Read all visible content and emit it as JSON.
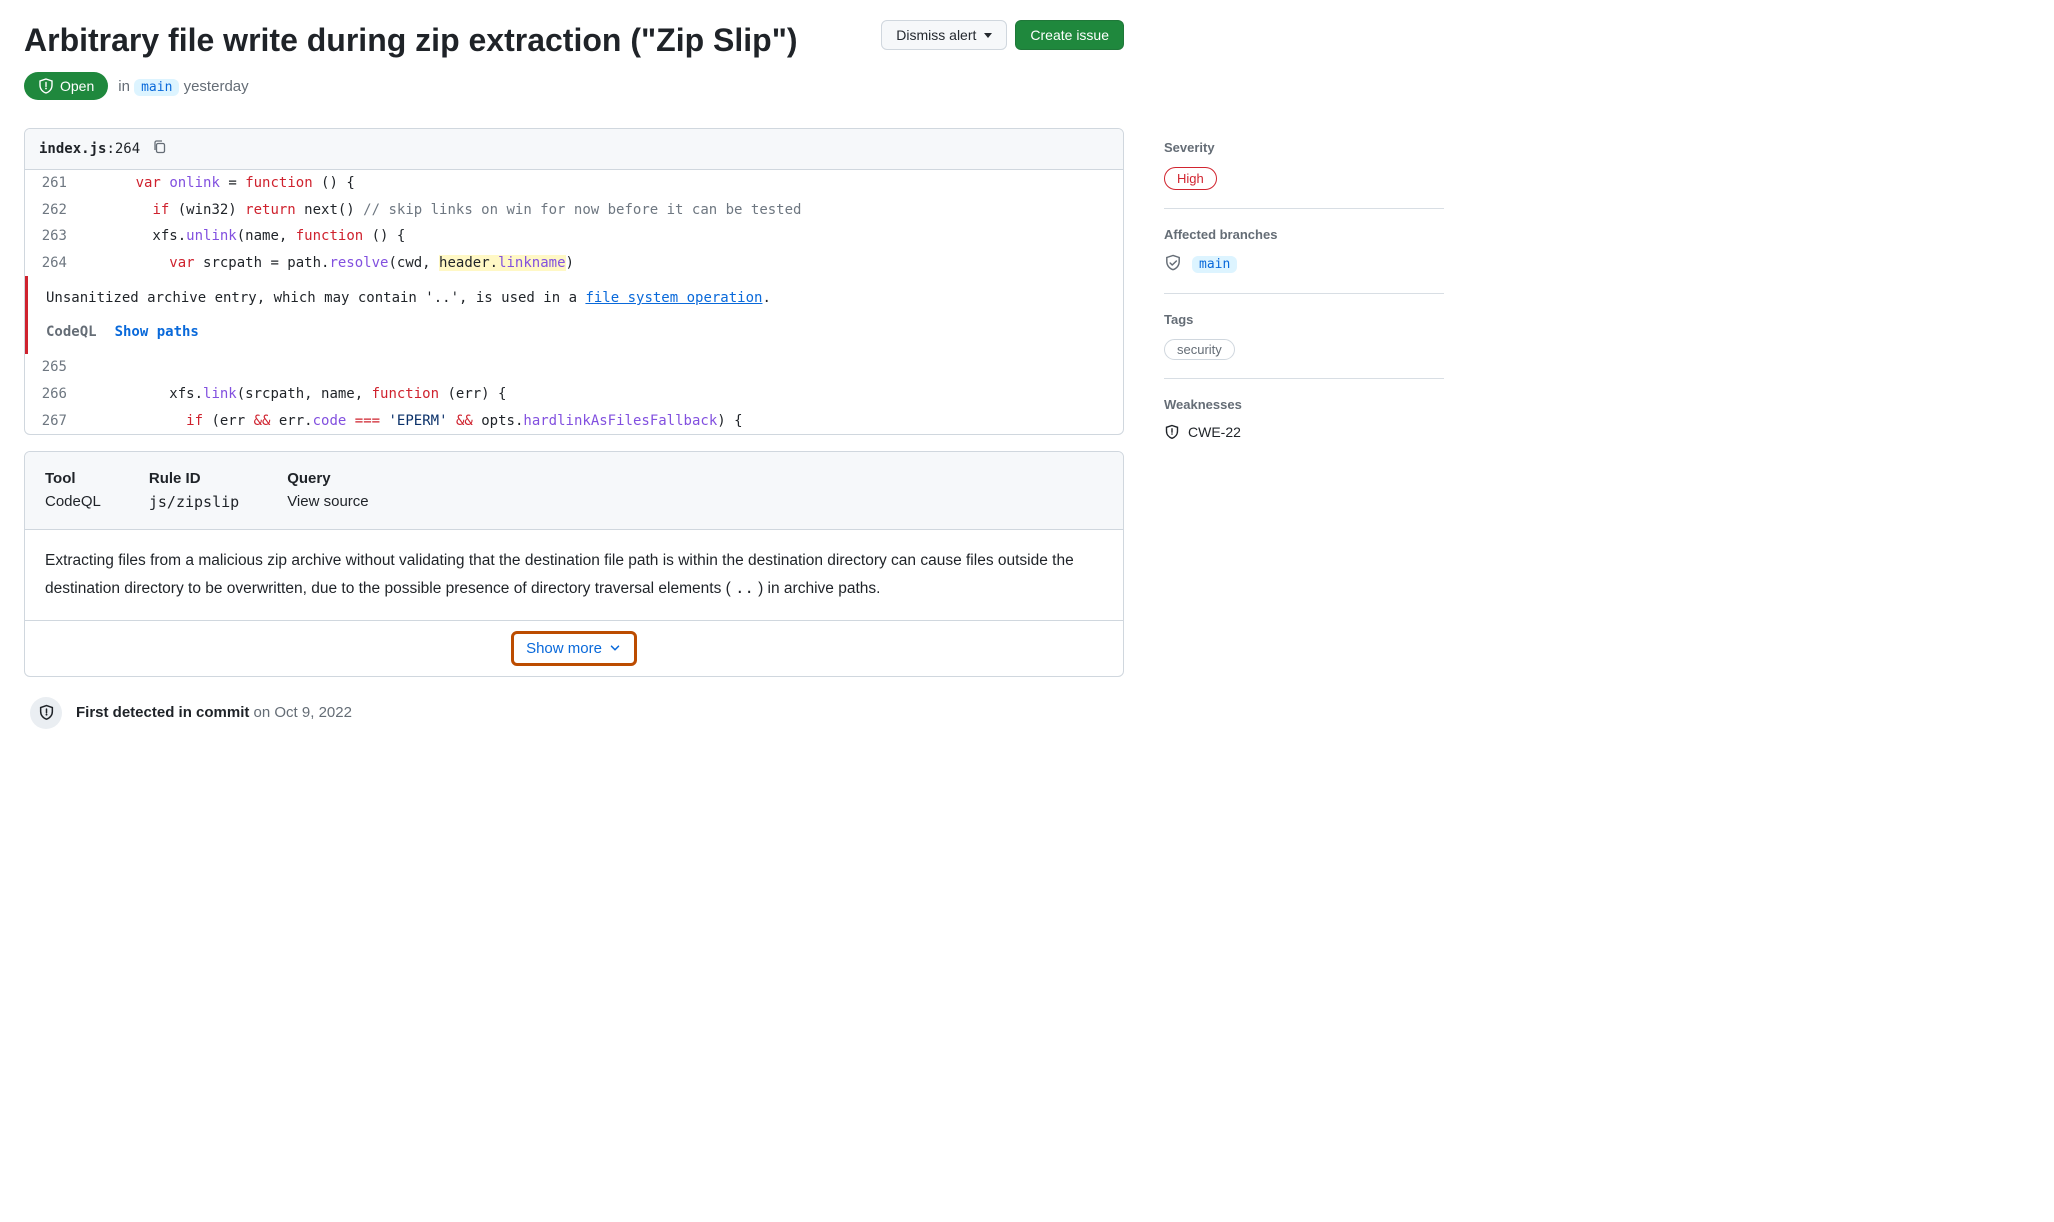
{
  "header": {
    "title": "Arbitrary file write during zip extraction (\"Zip Slip\")",
    "dismiss_label": "Dismiss alert",
    "create_issue_label": "Create issue"
  },
  "status": {
    "state": "Open",
    "in_label": "in",
    "branch": "main",
    "when": "yesterday"
  },
  "code_header": {
    "filename": "index.js",
    "line": "264"
  },
  "code": {
    "lines_before": [
      {
        "num": "261",
        "tokens": [
          {
            "t": "      "
          },
          {
            "t": "var",
            "c": "kw"
          },
          {
            "t": " "
          },
          {
            "t": "onlink",
            "c": "fn"
          },
          {
            "t": " = "
          },
          {
            "t": "function",
            "c": "kw"
          },
          {
            "t": " () {"
          }
        ]
      },
      {
        "num": "262",
        "tokens": [
          {
            "t": "        "
          },
          {
            "t": "if",
            "c": "kw"
          },
          {
            "t": " (win32) "
          },
          {
            "t": "return",
            "c": "kw"
          },
          {
            "t": " next() "
          },
          {
            "t": "// skip links on win for now before it can be tested",
            "c": "cm"
          }
        ]
      },
      {
        "num": "263",
        "tokens": [
          {
            "t": "        xfs."
          },
          {
            "t": "unlink",
            "c": "fn"
          },
          {
            "t": "(name, "
          },
          {
            "t": "function",
            "c": "kw"
          },
          {
            "t": " () {"
          }
        ]
      },
      {
        "num": "264",
        "tokens": [
          {
            "t": "          "
          },
          {
            "t": "var",
            "c": "kw"
          },
          {
            "t": " srcpath = path."
          },
          {
            "t": "resolve",
            "c": "fn"
          },
          {
            "t": "(cwd, "
          },
          {
            "t": "header.",
            "c": "hl"
          },
          {
            "t": "linkname",
            "c": "hl-fn"
          },
          {
            "t": ")"
          }
        ]
      }
    ],
    "lines_after": [
      {
        "num": "265",
        "tokens": []
      },
      {
        "num": "266",
        "tokens": [
          {
            "t": "          xfs."
          },
          {
            "t": "link",
            "c": "fn"
          },
          {
            "t": "(srcpath, name, "
          },
          {
            "t": "function",
            "c": "kw"
          },
          {
            "t": " (err) {"
          }
        ]
      },
      {
        "num": "267",
        "tokens": [
          {
            "t": "            "
          },
          {
            "t": "if",
            "c": "kw"
          },
          {
            "t": " (err "
          },
          {
            "t": "&&",
            "c": "kw"
          },
          {
            "t": " err."
          },
          {
            "t": "code",
            "c": "fn"
          },
          {
            "t": " "
          },
          {
            "t": "===",
            "c": "kw"
          },
          {
            "t": " "
          },
          {
            "t": "'EPERM'",
            "c": "str"
          },
          {
            "t": " "
          },
          {
            "t": "&&",
            "c": "kw"
          },
          {
            "t": " opts."
          },
          {
            "t": "hardlinkAsFilesFallback",
            "c": "fn"
          },
          {
            "t": ") {"
          }
        ]
      }
    ]
  },
  "alert": {
    "msg_pre": "Unsanitized archive entry, which may contain '..', is used in a ",
    "msg_link": "file system operation",
    "msg_post": ".",
    "codeql_label": "CodeQL",
    "show_paths": "Show paths"
  },
  "details": {
    "cols": [
      {
        "label": "Tool",
        "value": "CodeQL"
      },
      {
        "label": "Rule ID",
        "value": "js/zipslip",
        "mono": true
      },
      {
        "label": "Query",
        "value": "View source"
      }
    ],
    "body_pre": "Extracting files from a malicious zip archive without validating that the destination file path is within the destination directory can cause files outside the destination directory to be overwritten, due to the possible presence of directory traversal elements (",
    "body_code": "..",
    "body_post": ") in archive paths.",
    "show_more_label": "Show more"
  },
  "timeline": {
    "first_detected_bold": "First detected in commit",
    "first_detected_rest": " on Oct 9, 2022"
  },
  "sidebar": {
    "severity_heading": "Severity",
    "severity_value": "High",
    "branches_heading": "Affected branches",
    "branch_value": "main",
    "tags_heading": "Tags",
    "tag_value": "security",
    "weaknesses_heading": "Weaknesses",
    "weakness_value": "CWE-22"
  }
}
